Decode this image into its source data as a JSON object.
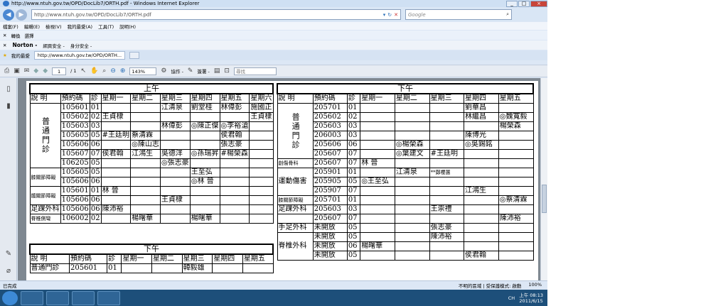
{
  "window": {
    "title": "http://www.ntuh.gov.tw/OPD/DocLib7/ORTH.pdf - Windows Internet Explorer",
    "controls": [
      "_",
      "□",
      "×"
    ]
  },
  "address": {
    "url": "http://www.ntuh.gov.tw/OPD/DocLib7/ORTH.pdf",
    "search_placeholder": "Google",
    "back_icon": "back-arrow-icon",
    "forward_icon": "forward-arrow-icon"
  },
  "menu": [
    "檔案(F)",
    "編輯(E)",
    "檢視(V)",
    "我的最愛(A)",
    "工具(T)",
    "說明(H)"
  ],
  "favbar": {
    "items": [
      "轉換",
      "選擇"
    ]
  },
  "norton": {
    "brand": "Norton -",
    "items": [
      "網頁安全 -",
      "身分安全 -"
    ]
  },
  "tabs": {
    "favorites": "我的最愛",
    "active": "http://www.ntuh.gov.tw/OPD/ORTH..."
  },
  "pdf_toolbar": {
    "page": "1",
    "of": "/ 1",
    "zoom": "143%",
    "collab": "協作 -",
    "sign": "簽署 -",
    "find_placeholder": "尋找"
  },
  "schedule": {
    "morning_band": "上午",
    "afternoon_band": "下午",
    "headers": [
      "說 明",
      "預約碼",
      "診",
      "星期一",
      "星期二",
      "星期三",
      "星期四",
      "星期五",
      "星期六"
    ],
    "left_morning": {
      "group_general": "普通門診",
      "general_rows": [
        [
          "105601",
          "01",
          "",
          "",
          "江清泉",
          "劉堂桂",
          "林偉彭",
          "施國正"
        ],
        [
          "105602",
          "02",
          "王貞棣",
          "",
          "",
          "",
          "",
          "王貞棣"
        ],
        [
          "105603",
          "03",
          "",
          "",
          "林偉彭",
          "◎陳正傑",
          "◎李裕滄",
          ""
        ],
        [
          "105605",
          "05",
          "#王廷明",
          "蔡清霖",
          "",
          "",
          "侯君翰",
          ""
        ],
        [
          "105606",
          "06",
          "",
          "◎陳山志",
          "",
          "",
          "張志豪",
          ""
        ],
        [
          "105607",
          "07",
          "侯君翰",
          "江鴻生",
          "吳德洋",
          "◎孫瑞昇",
          "#楊榮森",
          ""
        ],
        [
          "106205",
          "05",
          "",
          "",
          "◎張志豪",
          "",
          "",
          ""
        ]
      ],
      "group_joint": "膝關節障礙",
      "joint_rows": [
        [
          "105605",
          "05",
          "",
          "",
          "",
          "王至弘",
          "",
          ""
        ],
        [
          "105606",
          "06",
          "",
          "",
          "",
          "◎林 晉",
          "",
          ""
        ]
      ],
      "hip_label": "髖關節障礙",
      "hip_rows": [
        [
          "105601",
          "01",
          "林 晉",
          "",
          "",
          "",
          "",
          ""
        ],
        [
          "105606",
          "06",
          "",
          "",
          "王貞棣",
          "",
          "",
          ""
        ]
      ],
      "ankle_label": "足踝外科",
      "ankle_rows": [
        [
          "105606",
          "06",
          "陳沛裕",
          "",
          "",
          "",
          "",
          ""
        ]
      ],
      "spine_label": "脊椎側彎",
      "spine_rows": [
        [
          "106002",
          "02",
          "",
          "楊曙華",
          "",
          "楊曙華",
          "",
          ""
        ]
      ]
    },
    "left_afternoon": {
      "headers": [
        "說 明",
        "預約碼",
        "診",
        "星期一",
        "星期二",
        "星期三",
        "星期四",
        "星期五"
      ],
      "rows": [
        [
          "普通門診",
          "205601",
          "01",
          "",
          "",
          "韓毅雄",
          "",
          ""
        ]
      ]
    },
    "right": {
      "headers": [
        "說 明",
        "預約碼",
        "診",
        "星期一",
        "星期二",
        "星期三",
        "星期四",
        "星期五"
      ],
      "group_general": "普通門診",
      "general_rows": [
        [
          "205701",
          "01",
          "",
          "",
          "",
          "劉華昌",
          ""
        ],
        [
          "205602",
          "02",
          "",
          "",
          "",
          "林繼昌",
          "◎魏寬毅"
        ],
        [
          "205603",
          "03",
          "",
          "",
          "",
          "",
          "楊榮森"
        ],
        [
          "206003",
          "03",
          "",
          "",
          "",
          "陳博光",
          ""
        ],
        [
          "205606",
          "06",
          "",
          "◎楊榮森",
          "",
          "◎吳錫銘",
          ""
        ],
        [
          "205607",
          "07",
          "",
          "◎葉建文",
          "#王廷明",
          "",
          ""
        ]
      ],
      "trauma_label": "創傷骨科",
      "trauma_rows": [
        [
          "205607",
          "07",
          "林 晉",
          "",
          "",
          "",
          ""
        ]
      ],
      "sports_label": "運動傷害",
      "sports_rows": [
        [
          "205901",
          "01",
          "",
          "江清泉",
          "**鄭櫻蕙",
          "",
          ""
        ],
        [
          "205905",
          "05",
          "◎王至弘",
          "",
          "",
          "",
          ""
        ],
        [
          "205907",
          "07",
          "",
          "",
          "",
          "江鴻生",
          ""
        ]
      ],
      "knee_label": "膝關節障礙",
      "knee_rows": [
        [
          "205701",
          "01",
          "",
          "",
          "",
          "",
          "◎蔡清霖"
        ]
      ],
      "foot_label": "足踝外科",
      "foot_rows": [
        [
          "205603",
          "03",
          "",
          "",
          "王崇禮",
          "",
          ""
        ]
      ],
      "extra_rows": [
        [
          "205607",
          "07",
          "",
          "",
          "",
          "",
          "陳沛裕"
        ]
      ],
      "hand_label": "手足外科",
      "hand_rows": [
        [
          "未開放",
          "05",
          "",
          "",
          "張志豪",
          "",
          ""
        ]
      ],
      "spine_label": "脊椎外科",
      "spine_rows": [
        [
          "未開放",
          "05",
          "",
          "",
          "陳沛裕",
          "",
          ""
        ],
        [
          "未開放",
          "06",
          "楊曙華",
          "",
          "",
          "",
          ""
        ],
        [
          "未開放",
          "05",
          "",
          "",
          "",
          "侯君翰",
          ""
        ]
      ]
    }
  },
  "status": {
    "left": "已完成",
    "zone": "不明的區域 | 受保護模式: 啟動",
    "zoom": "100%"
  },
  "taskbar": {
    "lang": "CH",
    "time": "上午 08:13",
    "date": "2011/6/15"
  }
}
